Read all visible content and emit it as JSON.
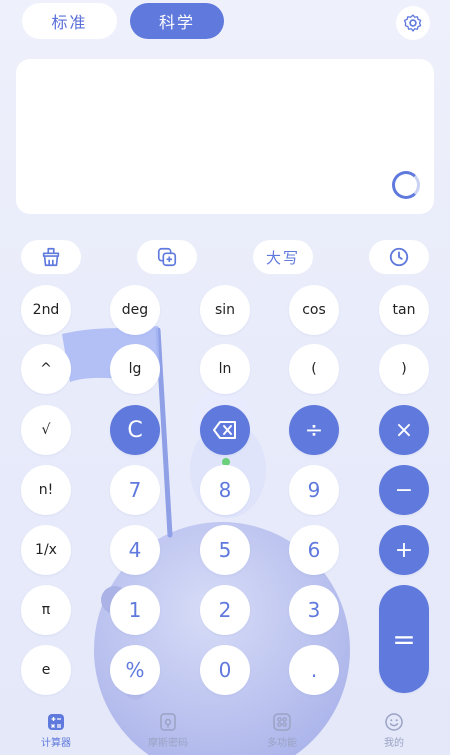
{
  "mode_tabs": {
    "standard": "标准",
    "scientific": "科学",
    "active": "scientific"
  },
  "icons": {
    "settings": "gear-icon",
    "clear_history": "broom-icon",
    "copy": "copy-plus-icon",
    "history": "clock-icon",
    "loading": "loading-ring-icon"
  },
  "toolbar": {
    "uppercase_label": "大写"
  },
  "keys": {
    "row1": [
      "2nd",
      "deg",
      "sin",
      "cos",
      "tan"
    ],
    "row2": [
      "^",
      "lg",
      "ln",
      "(",
      ")"
    ],
    "row3": [
      "√",
      "C",
      "⌫",
      "÷",
      "×"
    ],
    "row4": [
      "n!",
      "7",
      "8",
      "9",
      "−"
    ],
    "row5": [
      "1/x",
      "4",
      "5",
      "6",
      "+"
    ],
    "row6": [
      "π",
      "1",
      "2",
      "3",
      "="
    ],
    "row7": [
      "e",
      "%",
      "0",
      "."
    ]
  },
  "nav": [
    {
      "label": "计算器",
      "icon": "calculator-icon"
    },
    {
      "label": "摩斯密码",
      "icon": "lock-icon"
    },
    {
      "label": "多功能",
      "icon": "grid-icon"
    },
    {
      "label": "我的",
      "icon": "smile-icon"
    }
  ],
  "colors": {
    "accent": "#5f79dc",
    "background": "#eef0fb"
  }
}
